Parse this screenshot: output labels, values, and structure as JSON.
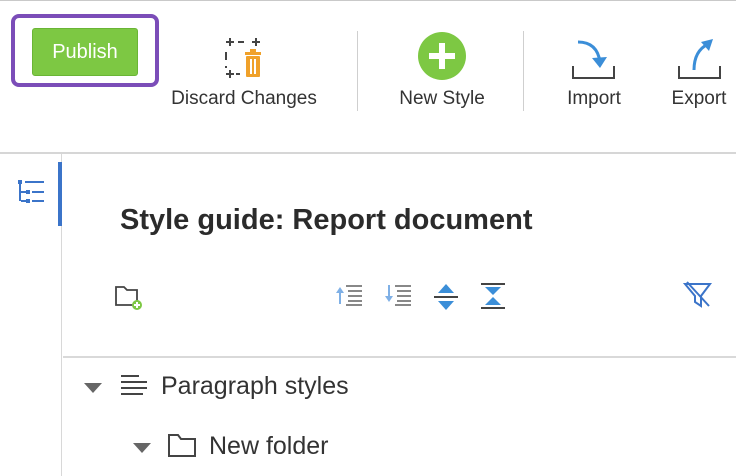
{
  "toolbar": {
    "publish_label": "Publish",
    "discard_label": "Discard Changes",
    "new_style_label": "New Style",
    "import_label": "Import",
    "export_label": "Export"
  },
  "panel": {
    "title": "Style guide: Report document"
  },
  "tree": {
    "items": [
      {
        "label": "Paragraph styles",
        "icon": "paragraph-lines-icon",
        "expanded": true
      },
      {
        "label": "New folder",
        "icon": "folder-icon",
        "expanded": true
      }
    ]
  },
  "colors": {
    "publish_green": "#7dc843",
    "highlight_purple": "#7b4db8",
    "accent_blue": "#3b8ed8",
    "rail_active_blue": "#3b74c9",
    "trash_orange": "#f0a12a"
  }
}
